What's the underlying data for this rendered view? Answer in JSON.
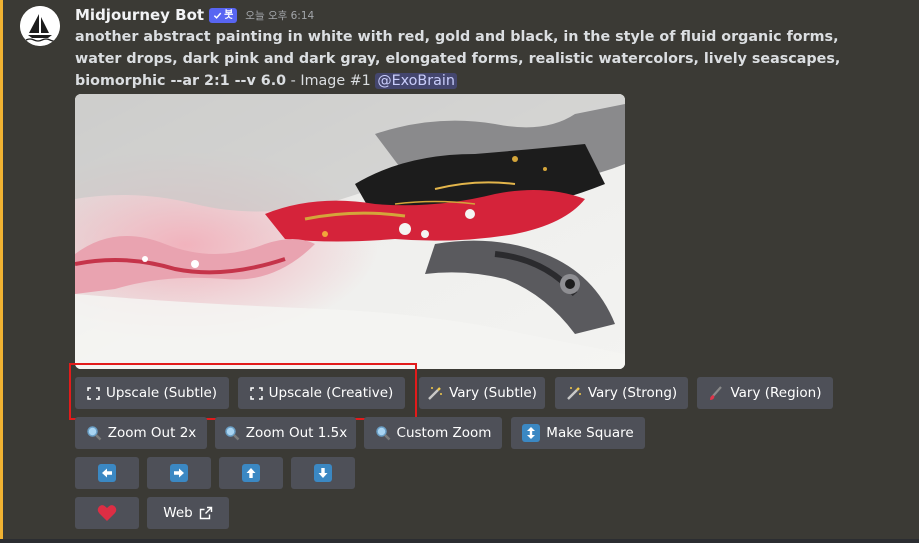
{
  "author": {
    "name": "Midjourney Bot",
    "bot_badge": "봇",
    "timestamp": "오늘 오후 6:14"
  },
  "message": {
    "prompt": "another abstract painting in white with red, gold and black, in the style of fluid organic forms, water drops, dark pink and dark gray, elongated forms, realistic watercolors, lively seascapes, biomorphic --ar 2:1 --v 6.0",
    "suffix": " - Image #1 ",
    "mention": "@ExoBrain"
  },
  "image": {
    "description_icon": "abstract-fluid-painting",
    "colors": [
      "#ffffff",
      "#d5233a",
      "#d4a53a",
      "#1c1c1c",
      "#e9a3b0",
      "#5a5a5e"
    ]
  },
  "buttons": {
    "upscale_subtle": "Upscale (Subtle)",
    "upscale_creative": "Upscale (Creative)",
    "vary_subtle": "Vary (Subtle)",
    "vary_strong": "Vary (Strong)",
    "vary_region": "Vary (Region)",
    "zoom_out_2x": "Zoom Out 2x",
    "zoom_out_1_5x": "Zoom Out 1.5x",
    "custom_zoom": "Custom Zoom",
    "make_square": "Make Square",
    "web": "Web"
  },
  "icons": {
    "upscale": "expand-corners-icon",
    "vary": "magic-wand-icon",
    "vary_region": "paintbrush-icon",
    "zoom": "magnifier-icon",
    "make_square": "up-down-arrow-icon",
    "pan": [
      "left-arrow-icon",
      "right-arrow-icon",
      "up-arrow-icon",
      "down-arrow-icon"
    ],
    "favorite": "heart-icon",
    "external": "external-link-icon"
  },
  "colors": {
    "background": "#3b3a35",
    "button": "#4e5058",
    "accent_bar": "#f0b232",
    "highlight": "#e21b1b",
    "bot_badge": "#5865f2"
  }
}
